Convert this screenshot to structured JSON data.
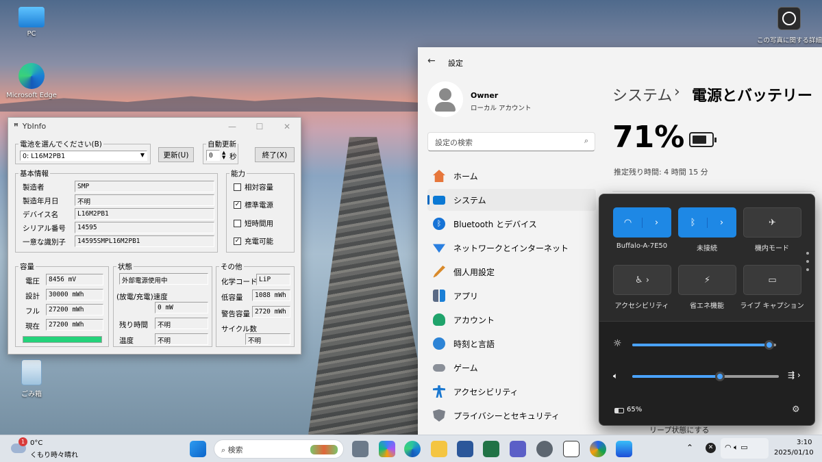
{
  "desktop": {
    "icons": [
      {
        "label": "PC"
      },
      {
        "label": "Microsoft Edge"
      },
      {
        "label": "ごみ箱"
      }
    ],
    "photo_info": "この写真に関する詳細"
  },
  "ybinfo": {
    "title": "YbInfo",
    "battery_select_label": "電池を選んでください(B)",
    "battery_select_value": "0: L16M2PB1",
    "update_button": "更新(U)",
    "auto_update_label": "自動更新",
    "auto_update_value": "0",
    "seconds_label": "秒",
    "exit_button": "終了(X)",
    "basic": {
      "legend": "基本情報",
      "rows": [
        {
          "label": "製造者",
          "value": "SMP"
        },
        {
          "label": "製造年月日",
          "value": "不明"
        },
        {
          "label": "デバイス名",
          "value": "L16M2PB1"
        },
        {
          "label": "シリアル番号",
          "value": "14595"
        },
        {
          "label": "一意な識別子",
          "value": "14595SMPL16M2PB1"
        }
      ]
    },
    "ability": {
      "legend": "能力",
      "items": [
        {
          "label": "相対容量",
          "checked": false
        },
        {
          "label": "標準電源",
          "checked": true
        },
        {
          "label": "短時間用",
          "checked": false
        },
        {
          "label": "充電可能",
          "checked": true
        }
      ]
    },
    "capacity": {
      "legend": "容量",
      "rows": [
        {
          "label": "電圧",
          "value": "8456 mV"
        },
        {
          "label": "設計",
          "value": "30000 mWh"
        },
        {
          "label": "フル",
          "value": "27200 mWh"
        },
        {
          "label": "現在",
          "value": "27200 mWh"
        }
      ],
      "level": 1.0,
      "bar_color": "#24d27a"
    },
    "status": {
      "legend": "状態",
      "state": "外部電源使用中",
      "rate_label": "(放電/充電)速度",
      "rate_value": "0 mW",
      "remain_label": "残り時間",
      "remain_value": "不明",
      "temp_label": "温度",
      "temp_value": "不明"
    },
    "other": {
      "legend": "その他",
      "chem_label": "化学コード",
      "chem_value": "LiP",
      "low_label": "低容量",
      "low_value": "1088 mWh",
      "warn_label": "警告容量",
      "warn_value": "2720 mWh",
      "cycle_label": "サイクル数",
      "cycle_value": "不明"
    }
  },
  "settings": {
    "title": "設定",
    "user_name": "Owner",
    "user_type": "ローカル アカウント",
    "search_placeholder": "設定の検索",
    "nav": [
      {
        "label": "ホーム",
        "icon": "home-icon",
        "color": "#e6763b"
      },
      {
        "label": "システム",
        "icon": "system-icon",
        "color": "#0a78d4"
      },
      {
        "label": "Bluetooth とデバイス",
        "icon": "bluetooth-icon",
        "color": "#1673d6"
      },
      {
        "label": "ネットワークとインターネット",
        "icon": "network-icon",
        "color": "#2a7fe0"
      },
      {
        "label": "個人用設定",
        "icon": "brush-icon",
        "color": "#d98a2b"
      },
      {
        "label": "アプリ",
        "icon": "apps-icon",
        "color": "#5a6a85"
      },
      {
        "label": "アカウント",
        "icon": "account-icon",
        "color": "#1fa36b"
      },
      {
        "label": "時刻と言語",
        "icon": "clock-icon",
        "color": "#2d84d6"
      },
      {
        "label": "ゲーム",
        "icon": "game-icon",
        "color": "#8a8f98"
      },
      {
        "label": "アクセシビリティ",
        "icon": "accessibility-icon",
        "color": "#1b78d0"
      },
      {
        "label": "プライバシーとセキュリティ",
        "icon": "shield-icon",
        "color": "#7b8089"
      }
    ],
    "breadcrumb_parent": "システム",
    "breadcrumb_sep": "›",
    "page_title": "電源とバッテリー",
    "battery_percent": "71%",
    "remaining": "推定残り時間: 4 時間 15 分",
    "sleep_text": "リープ状態にする"
  },
  "quick": {
    "tiles": [
      {
        "label": "Buffalo-A-7E50",
        "icon": "wifi-icon",
        "on": true
      },
      {
        "label": "未接続",
        "icon": "bluetooth-icon",
        "on": true
      },
      {
        "label": "機内モード",
        "icon": "airplane-icon",
        "on": false
      },
      {
        "label": "アクセシビリティ",
        "icon": "accessibility-icon",
        "on": false
      },
      {
        "label": "省エネ機能",
        "icon": "energy-saver-icon",
        "on": false
      },
      {
        "label": "ライブ キャプション",
        "icon": "caption-icon",
        "on": false
      }
    ],
    "brightness": 0.95,
    "volume": 0.6,
    "battery": "65%"
  },
  "taskbar": {
    "weather_temp": "0°C",
    "weather_text": "くもり時々晴れ",
    "weather_badge": "1",
    "search_placeholder": "検索",
    "time": "3:10",
    "date": "2025/01/10"
  }
}
